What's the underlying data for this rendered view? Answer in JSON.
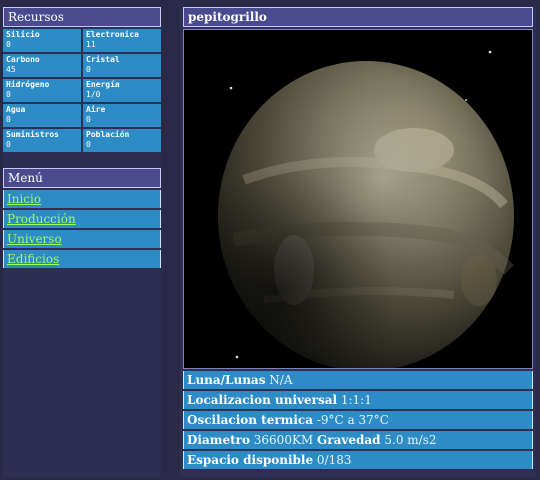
{
  "resources": {
    "title": "Recursos",
    "items": [
      {
        "name": "Silicio",
        "value": "0"
      },
      {
        "name": "Electronica",
        "value": "11"
      },
      {
        "name": "Carbono",
        "value": "45"
      },
      {
        "name": "Cristal",
        "value": "0"
      },
      {
        "name": "Hidrógeno",
        "value": "0"
      },
      {
        "name": "Energía",
        "value": "1/0"
      },
      {
        "name": "Agua",
        "value": "0"
      },
      {
        "name": "Aire",
        "value": "0"
      },
      {
        "name": "Suministros",
        "value": "0"
      },
      {
        "name": "Población",
        "value": "0"
      }
    ]
  },
  "menu": {
    "title": "Menú",
    "items": [
      "Inicio",
      "Producción",
      "Universo",
      "Edificios"
    ]
  },
  "planet": {
    "name": "pepitogrillo",
    "info": {
      "moons_label": "Luna/Lunas",
      "moons_value": "N/A",
      "location_label": "Localizacion universal",
      "location_value": "1:1:1",
      "temp_label": "Oscilacion termica",
      "temp_value": "-9°C a 37°C",
      "diameter_label": "Diametro",
      "diameter_value": "36600KM",
      "gravity_label": "Gravedad",
      "gravity_value": "5.0 m/s2",
      "space_label": "Espacio disponible",
      "space_value": "0/183"
    }
  },
  "colors": {
    "background": "#2a2a48",
    "header": "#4a4a8e",
    "cell": "#2d8bc6",
    "link": "#9cff5a"
  }
}
